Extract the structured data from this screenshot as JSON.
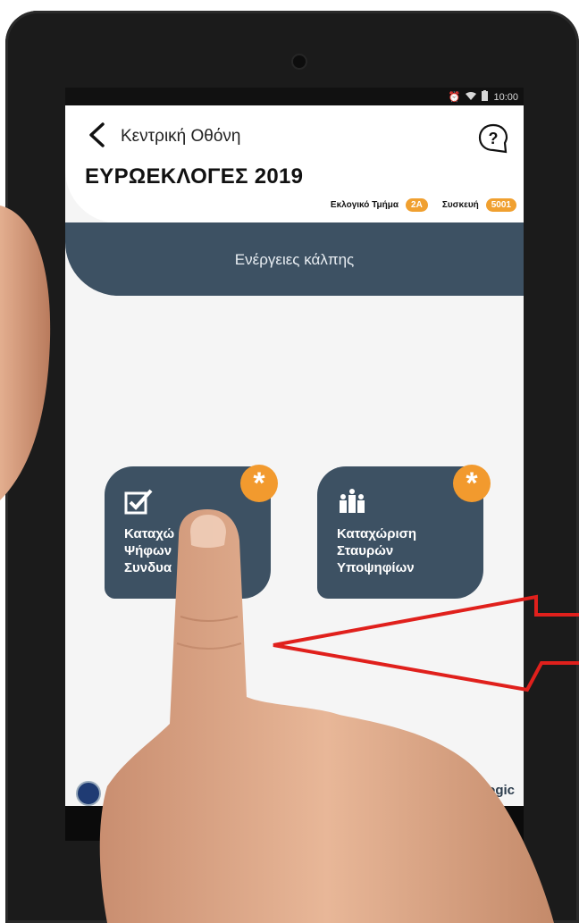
{
  "header": {
    "back_label": "Κεντρική Οθόνη",
    "title": "ΕΥΡΩΕΚΛΟΓΕΣ 2019",
    "section_label": "Εκλογικό Τμήμα",
    "section_value": "2A",
    "device_label": "Συσκευή",
    "device_value": "5001"
  },
  "status_bar": {
    "time": "10:00"
  },
  "banner": {
    "text": "Ενέργειες κάλπης"
  },
  "tiles": [
    {
      "label": "Καταχώ\nΨήφων\nΣυνδυα",
      "icon": "checkbox-icon",
      "badge": "*"
    },
    {
      "label": "Καταχώριση\nΣταυρών\nΥποψηφίων",
      "icon": "candidates-icon",
      "badge": "*"
    }
  ],
  "footer": {
    "logo_text": "ogic"
  },
  "colors": {
    "navy": "#3d5163",
    "accent": "#f29a2e",
    "arrow": "#e0201c"
  }
}
